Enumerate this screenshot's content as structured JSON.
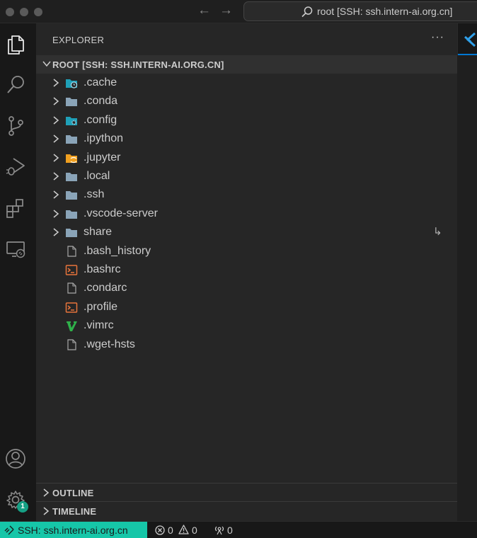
{
  "titlebar": {
    "search_text": "root [SSH: ssh.intern-ai.org.cn]"
  },
  "activity": {
    "accounts_badge": "1"
  },
  "explorer": {
    "title": "EXPLORER",
    "more_label": "···",
    "root_label": "ROOT [SSH: SSH.INTERN-AI.ORG.CN]",
    "items": [
      {
        "label": ".cache",
        "kind": "folder",
        "icon": "folder-cache-icon"
      },
      {
        "label": ".conda",
        "kind": "folder",
        "icon": "folder-icon"
      },
      {
        "label": ".config",
        "kind": "folder",
        "icon": "folder-config-icon"
      },
      {
        "label": ".ipython",
        "kind": "folder",
        "icon": "folder-icon"
      },
      {
        "label": ".jupyter",
        "kind": "folder",
        "icon": "folder-jupyter-icon"
      },
      {
        "label": ".local",
        "kind": "folder",
        "icon": "folder-icon"
      },
      {
        "label": ".ssh",
        "kind": "folder",
        "icon": "folder-icon"
      },
      {
        "label": ".vscode-server",
        "kind": "folder",
        "icon": "folder-icon"
      },
      {
        "label": "share",
        "kind": "folder",
        "icon": "folder-icon",
        "symlink": true
      },
      {
        "label": ".bash_history",
        "kind": "file",
        "icon": "file-icon"
      },
      {
        "label": ".bashrc",
        "kind": "file",
        "icon": "terminal-file-icon"
      },
      {
        "label": ".condarc",
        "kind": "file",
        "icon": "file-icon"
      },
      {
        "label": ".profile",
        "kind": "file",
        "icon": "terminal-file-icon"
      },
      {
        "label": ".vimrc",
        "kind": "file",
        "icon": "vim-icon"
      },
      {
        "label": ".wget-hsts",
        "kind": "file",
        "icon": "file-icon"
      }
    ]
  },
  "sections": {
    "outline": "OUTLINE",
    "timeline": "TIMELINE"
  },
  "statusbar": {
    "remote_label": "SSH: ssh.intern-ai.org.cn",
    "errors": "0",
    "warnings": "0",
    "ports": "0"
  },
  "colors": {
    "accent": "#16c6a8",
    "badge": "#16a085",
    "folder": "#8aa4b8",
    "terminal": "#e8743b",
    "vim": "#2fb14a"
  }
}
